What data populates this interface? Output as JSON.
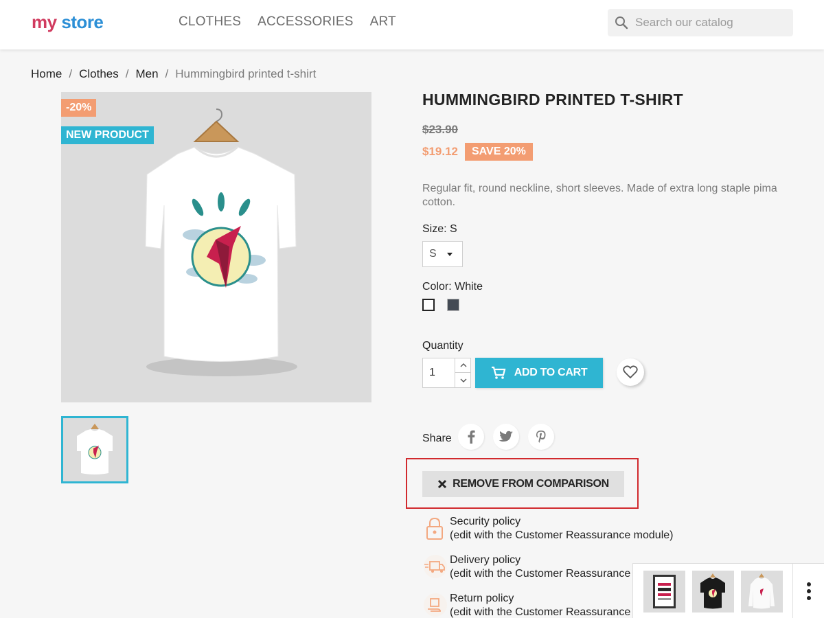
{
  "header": {
    "logo_part1": "my",
    "logo_part2": "store",
    "nav": [
      "CLOTHES",
      "ACCESSORIES",
      "ART"
    ],
    "search_placeholder": "Search our catalog"
  },
  "breadcrumb": [
    "Home",
    "Clothes",
    "Men",
    "Hummingbird printed t-shirt"
  ],
  "product": {
    "discount_flag": "-20%",
    "new_flag": "NEW PRODUCT",
    "title": "HUMMINGBIRD PRINTED T-SHIRT",
    "old_price": "$23.90",
    "new_price": "$19.12",
    "save_badge": "SAVE 20%",
    "description": "Regular fit, round neckline, short sleeves. Made of extra long staple pima cotton.",
    "size_label": "Size: S",
    "size_value": "S",
    "color_label": "Color: White",
    "colors": [
      "#ffffff",
      "#434a54"
    ],
    "quantity_label": "Quantity",
    "quantity_value": "1",
    "add_to_cart": "ADD TO CART",
    "share_label": "Share",
    "remove_comparison": "REMOVE FROM COMPARISON"
  },
  "reassurance": [
    {
      "title": "Security policy",
      "sub": "(edit with the Customer Reassurance module)",
      "icon": "lock-icon"
    },
    {
      "title": "Delivery policy",
      "sub": "(edit with the Customer Reassurance module)",
      "icon": "truck-icon"
    },
    {
      "title": "Return policy",
      "sub": "(edit with the Customer Reassurance module)",
      "icon": "return-box-icon"
    }
  ],
  "colors": {
    "accent": "#2fb5d2",
    "discount": "#f39d72",
    "highlight": "#d12a2e"
  }
}
